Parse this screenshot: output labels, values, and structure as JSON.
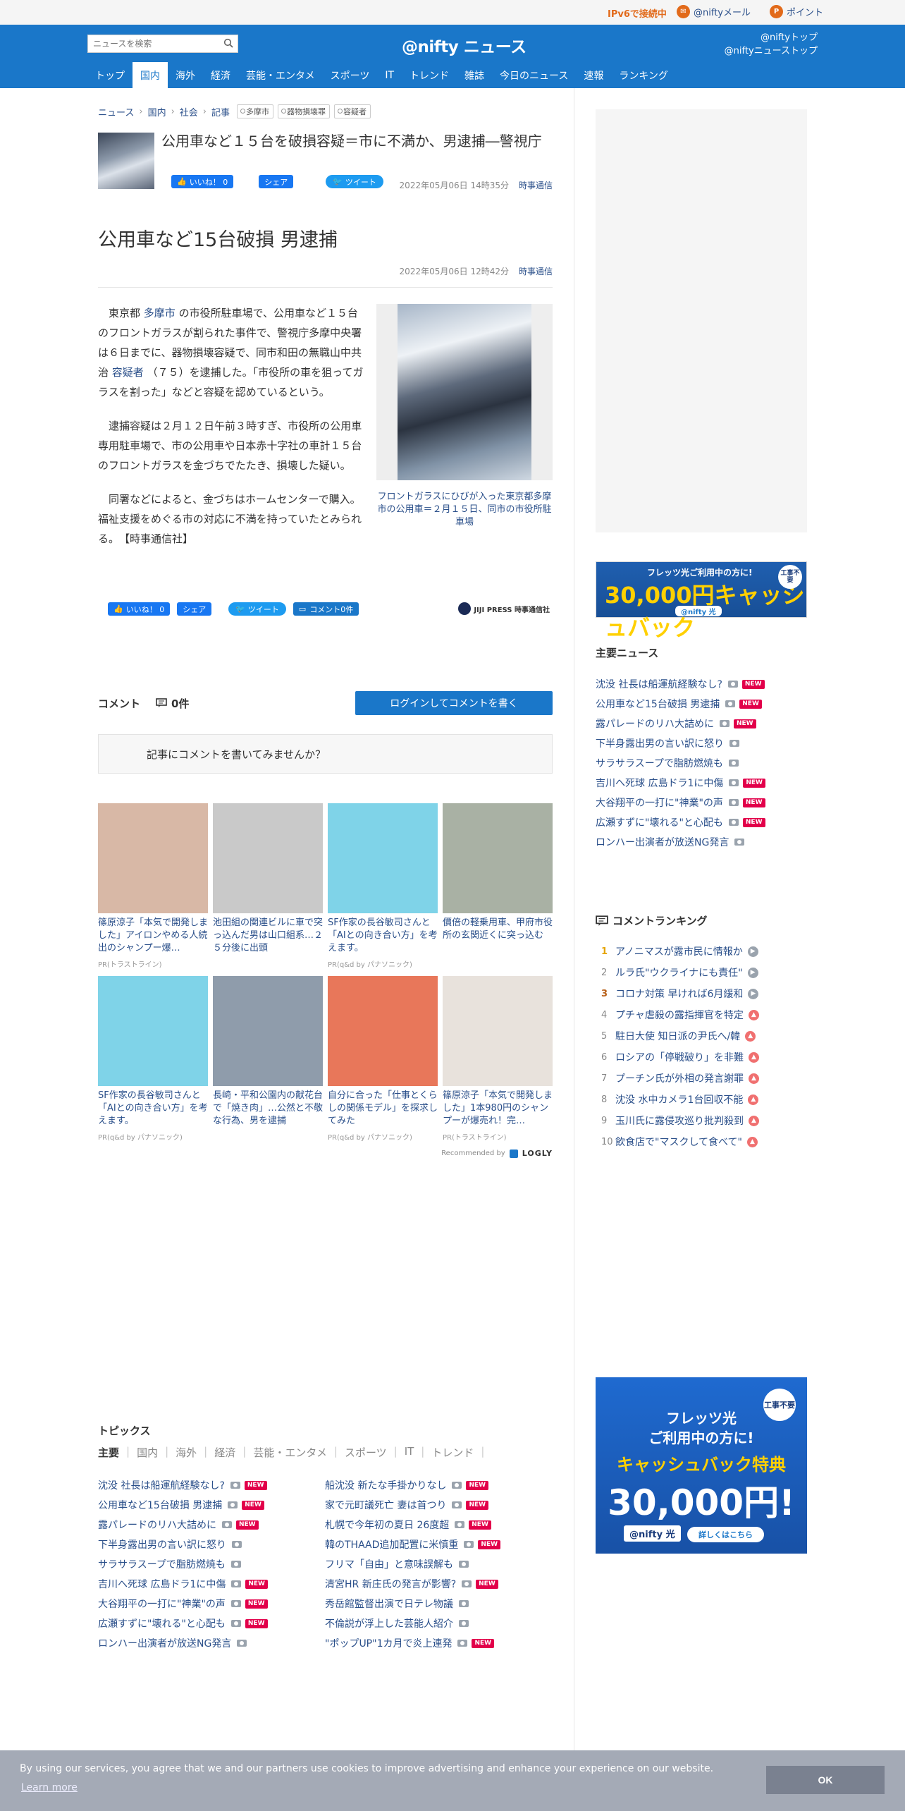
{
  "util": {
    "ipv6": "IPv6で接続中",
    "mail": "@niftyメール",
    "point": "ポイント"
  },
  "header": {
    "search_placeholder": "ニュースを検索",
    "logo": "@nifty ニュース",
    "toplink1": "@niftyトップ",
    "toplink2": "@niftyニューストップ"
  },
  "nav": [
    "トップ",
    "国内",
    "海外",
    "経済",
    "芸能・エンタメ",
    "スポーツ",
    "IT",
    "トレンド",
    "雑誌",
    "今日のニュース",
    "速報",
    "ランキング"
  ],
  "breadcrumb": {
    "items": [
      "ニュース",
      "国内",
      "社会",
      "記事"
    ],
    "tags": [
      "多摩市",
      "器物損壊罪",
      "容疑者"
    ]
  },
  "headline": {
    "title": "公用車など１５台を破損容疑＝市に不満か、男逮捕―警視庁",
    "date": "2022年05月06日 14時35分",
    "source": "時事通信"
  },
  "share": {
    "like": "いいね！ 0",
    "share": "シェア",
    "tweet": "ツイート",
    "comment": "コメント0件"
  },
  "article": {
    "title": "公用車など15台破損 男逮捕",
    "date": "2022年05月06日 12時42分",
    "source": "時事通信",
    "p1_a": "東京都",
    "p1_link1": "多摩市",
    "p1_b": "の市役所駐車場で、公用車など１５台のフロントガラスが割られた事件で、警視庁多摩中央署は６日までに、器物損壊容疑で、同市和田の無職山中共治",
    "p1_link2": "容疑者",
    "p1_c": "（７５）を逮捕した。「市役所の車を狙ってガラスを割った」などと容疑を認めているという。",
    "p2": "逮捕容疑は２月１２日午前３時すぎ、市役所の公用車専用駐車場で、市の公用車や日本赤十字社の車計１５台のフロントガラスを金づちでたたき、損壊した疑い。",
    "p3": "同署などによると、金づちはホームセンターで購入。福祉支援をめぐる市の対応に不満を持っていたとみられる。　【時事通信社】",
    "caption": "フロントガラスにひびが入った東京都多摩市の公用車＝２月１５日、同市の市役所駐車場",
    "jiji": "JIJI PRESS 時事通信社"
  },
  "comments": {
    "label": "コメント",
    "count": "0件",
    "login": "ログインしてコメントを書く",
    "prompt": "記事にコメントを書いてみませんか？"
  },
  "reco": {
    "row1": [
      {
        "title": "篠原涼子「本気で開発しました」アイロンやめる人続出のシャンプー爆…",
        "pr": "PR(トラストライン)",
        "color": "#d8b8a6"
      },
      {
        "title": "池田組の関連ビルに車で突っ込んだ男は山口組系…２５分後に出頭",
        "pr": "",
        "color": "#c9c9c9"
      },
      {
        "title": "SF作家の長谷敏司さんと「AIとの向き合い方」を考えます。",
        "pr": "PR(q&d by パナソニック)",
        "color": "#7fd3e8"
      },
      {
        "title": "價倍の軽乗用車、甲府市役所の玄関近くに突っ込む",
        "pr": "",
        "color": "#a9b1a4"
      }
    ],
    "row2": [
      {
        "title": "SF作家の長谷敏司さんと「AIとの向き合い方」を考えます。",
        "pr": "PR(q&d by パナソニック)",
        "color": "#7fd3e8"
      },
      {
        "title": "長崎・平和公園内の献花台で「焼き肉」…公然と不敬な行為、男を逮捕",
        "pr": "",
        "color": "#8f9cab"
      },
      {
        "title": "自分に合った「仕事とくらしの関係モデル」を探求してみた",
        "pr": "PR(q&d by パナソニック)",
        "color": "#e8775a"
      },
      {
        "title": "篠原涼子「本気で開発しました」1本980円のシャンプーが爆売れ！完…",
        "pr": "PR(トラストライン)",
        "color": "#e8e2dc"
      }
    ],
    "recommended": "Recommended by",
    "logly": "LOGLY"
  },
  "topics": {
    "title": "トピックス",
    "tabs": [
      "主要",
      "国内",
      "海外",
      "経済",
      "芸能・エンタメ",
      "スポーツ",
      "IT",
      "トレンド"
    ],
    "left": [
      {
        "t": "沈没 社長は船運航経験なし?",
        "new": true
      },
      {
        "t": "公用車など15台破損 男逮捕",
        "new": true
      },
      {
        "t": "露パレードのリハ大詰めに",
        "new": true
      },
      {
        "t": "下半身露出男の言い訳に怒り",
        "new": false
      },
      {
        "t": "サラサラスープで脂肪燃焼も",
        "new": false
      },
      {
        "t": "吉川へ死球 広島ドラ1に中傷",
        "new": true
      },
      {
        "t": "大谷翔平の一打に\"神業\"の声",
        "new": true
      },
      {
        "t": "広瀬すずに\"壊れる\"と心配も",
        "new": true
      },
      {
        "t": "ロンハー出演者が放送NG発言",
        "new": false
      }
    ],
    "right": [
      {
        "t": "船沈没 新たな手掛かりなし",
        "new": true
      },
      {
        "t": "家で元町議死亡 妻は首つり",
        "new": true
      },
      {
        "t": "札幌で今年初の夏日 26度超",
        "new": true
      },
      {
        "t": "韓のTHAAD追加配置に米慎重",
        "new": true
      },
      {
        "t": "フリマ「自由」と意味誤解も",
        "new": false
      },
      {
        "t": "清宮HR 新庄氏の発言が影響?",
        "new": true
      },
      {
        "t": "秀岳館監督出演で日テレ物議",
        "new": false
      },
      {
        "t": "不倫説が浮上した芸能人紹介",
        "new": false
      },
      {
        "t": "\"ポップUP\"1カ月で炎上連発",
        "new": true
      }
    ]
  },
  "sidebar": {
    "banner1_top": "フレッツ光ご利用中の方に!",
    "banner1_big": "30,000円キャッシュバック",
    "banner1_sub": "@nifty 光",
    "banner1_badge": "工事不要",
    "main_news_title": "主要ニュース",
    "main_news": [
      {
        "t": "沈没 社長は船運航経験なし?",
        "new": true
      },
      {
        "t": "公用車など15台破損 男逮捕",
        "new": true
      },
      {
        "t": "露パレードのリハ大詰めに",
        "new": true
      },
      {
        "t": "下半身露出男の言い訳に怒り",
        "new": false
      },
      {
        "t": "サラサラスープで脂肪燃焼も",
        "new": false
      },
      {
        "t": "吉川へ死球 広島ドラ1に中傷",
        "new": true
      },
      {
        "t": "大谷翔平の一打に\"神業\"の声",
        "new": true
      },
      {
        "t": "広瀬すずに\"壊れる\"と心配も",
        "new": true
      },
      {
        "t": "ロンハー出演者が放送NG発言",
        "new": false
      }
    ],
    "rank_title": "コメントランキング",
    "rank": [
      {
        "n": "1",
        "t": "アノニマスが露市民に情報か",
        "d": "same"
      },
      {
        "n": "2",
        "t": "ルラ氏\"ウクライナにも責任\"",
        "d": "same"
      },
      {
        "n": "3",
        "t": "コロナ対策 早ければ6月緩和",
        "d": "same"
      },
      {
        "n": "4",
        "t": "プチャ虐殺の露指揮官を特定",
        "d": "up"
      },
      {
        "n": "5",
        "t": "駐日大使 知日派の尹氏へ/韓",
        "d": "up"
      },
      {
        "n": "6",
        "t": "ロシアの「停戦破り」を非難",
        "d": "up"
      },
      {
        "n": "7",
        "t": "プーチン氏が外相の発言謝罪",
        "d": "up"
      },
      {
        "n": "8",
        "t": "沈没 水中カメラ1台回収不能",
        "d": "up"
      },
      {
        "n": "9",
        "t": "玉川氏に露侵攻巡り批判殺到",
        "d": "up"
      },
      {
        "n": "10",
        "t": "飲食店で\"マスクして食べて\"",
        "d": "up"
      }
    ],
    "banner2_l1": "フレッツ光",
    "banner2_l2": "ご利用中の方に!",
    "banner2_l3": "キャッシュバック特典",
    "banner2_l4": "30,000円!",
    "banner2_badge": "工事不要",
    "banner2_logo": "@nifty 光",
    "banner2_cta": "詳しくはこちら"
  },
  "cookie": {
    "message": "By using our services, you agree that we and our partners use cookies to improve advertising and enhance your experience on our website.",
    "learn": "Learn more",
    "ok": "OK"
  }
}
